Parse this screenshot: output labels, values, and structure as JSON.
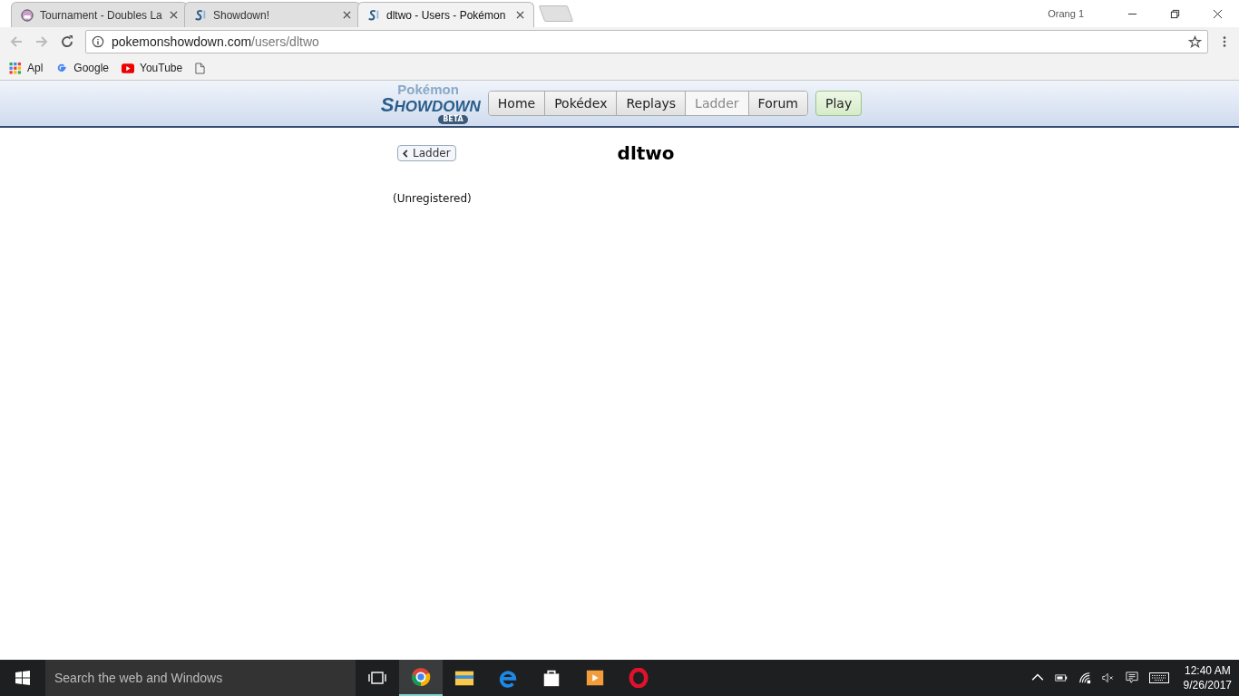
{
  "browser": {
    "tabs": [
      {
        "title": "Tournament - Doubles La",
        "kind": "pokemon",
        "selected": false
      },
      {
        "title": "Showdown!",
        "kind": "showdown",
        "selected": false
      },
      {
        "title": "dltwo - Users - Pokémon",
        "kind": "showdown",
        "selected": true
      }
    ],
    "profile": "Orang 1",
    "url_host": "pokemonshowdown.com",
    "url_path": "/users/dltwo",
    "bookmarks": [
      {
        "label": "Apl",
        "kind": "apps"
      },
      {
        "label": "Google",
        "kind": "google"
      },
      {
        "label": "YouTube",
        "kind": "youtube"
      },
      {
        "kind": "page"
      }
    ]
  },
  "site": {
    "logo": {
      "top": "Pokémon",
      "main": "SHOWDOWN",
      "badge": "BETA"
    },
    "nav": [
      {
        "label": "Home",
        "selected": false
      },
      {
        "label": "Pokédex",
        "selected": false
      },
      {
        "label": "Replays",
        "selected": false
      },
      {
        "label": "Ladder",
        "selected": true
      },
      {
        "label": "Forum",
        "selected": false
      }
    ],
    "play": "Play"
  },
  "page": {
    "back": "Ladder",
    "username": "dltwo",
    "status": "(Unregistered)"
  },
  "taskbar": {
    "search_placeholder": "Search the web and Windows",
    "apps": [
      {
        "kind": "chrome",
        "active": true
      },
      {
        "kind": "folder",
        "active": false
      },
      {
        "kind": "edge",
        "active": false
      },
      {
        "kind": "store",
        "active": false
      },
      {
        "kind": "media",
        "active": false
      },
      {
        "kind": "opera",
        "active": false
      }
    ],
    "time": "12:40 AM",
    "date": "9/26/2017"
  }
}
